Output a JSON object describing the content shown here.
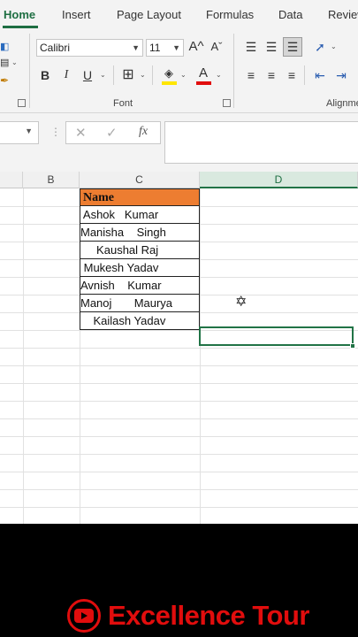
{
  "ribbon": {
    "tabs": [
      "Home",
      "Insert",
      "Page Layout",
      "Formulas",
      "Data",
      "Review"
    ],
    "font_name": "Calibri",
    "font_size": "11",
    "font_group_label": "Font",
    "alignment_group_label": "Alignment",
    "icons": {
      "bold": "B",
      "italic": "I",
      "underline": "U",
      "increase_font": "A^",
      "decrease_font": "Aˇ",
      "font_color": "A",
      "fx": "fx"
    },
    "colors": {
      "accent": "#217346",
      "highlight": "#ffe600",
      "font_color": "#e10d0d"
    }
  },
  "sheet": {
    "columns": [
      "B",
      "C",
      "D"
    ],
    "selected_column": "D",
    "header": "Name",
    "header_fill": "#ed7d31",
    "names": [
      " Ashok   Kumar",
      "Manisha    Singh",
      "     Kaushal Raj",
      " Mukesh Yadav",
      "Avnish    Kumar",
      "Manoj       Maurya",
      "    Kailash Yadav"
    ]
  },
  "brand": {
    "name": "Excellence Tour",
    "color": "#e10d0d"
  }
}
